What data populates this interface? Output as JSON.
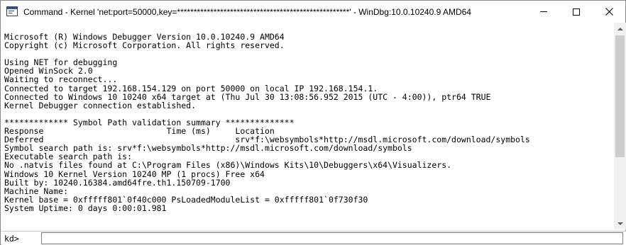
{
  "window": {
    "title": "Command - Kernel 'net:port=50000,key=****************************************************' - WinDbg:10.0.10240.9 AMD64",
    "close_glyph": "✕"
  },
  "output": {
    "lines": [
      "Microsoft (R) Windows Debugger Version 10.0.10240.9 AMD64",
      "Copyright (c) Microsoft Corporation. All rights reserved.",
      "",
      "Using NET for debugging",
      "Opened WinSock 2.0",
      "Waiting to reconnect...",
      "Connected to target 192.168.154.129 on port 50000 on local IP 192.168.154.1.",
      "Connected to Windows 10 10240 x64 target at (Thu Jul 30 13:08:56.952 2015 (UTC - 4:00)), ptr64 TRUE",
      "Kernel Debugger connection established.",
      "",
      "************* Symbol Path validation summary **************",
      "Response                         Time (ms)     Location",
      "Deferred                                       srv*f:\\websymbols*http://msdl.microsoft.com/download/symbols",
      "Symbol search path is: srv*f:\\websymbols*http://msdl.microsoft.com/download/symbols",
      "Executable search path is:",
      "No .natvis files found at C:\\Program Files (x86)\\Windows Kits\\10\\Debuggers\\x64\\Visualizers.",
      "Windows 10 Kernel Version 10240 MP (1 procs) Free x64",
      "Built by: 10240.16384.amd64fre.th1.150709-1700",
      "Machine Name:",
      "Kernel base = 0xfffff801`0f40c000 PsLoadedModuleList = 0xfffff801`0f730f30",
      "System Uptime: 0 days 0:00:01.981"
    ]
  },
  "command": {
    "prompt": "kd>",
    "value": "",
    "placeholder": ""
  },
  "colors": {
    "background": "#ffffff",
    "text": "#000000",
    "scrollbar_track": "#f0f0f0",
    "scrollbar_thumb": "#cdcdcd"
  },
  "icons": {
    "app": "windbg-command-icon",
    "minimize": "minimize-icon",
    "maximize": "maximize-icon",
    "close": "close-icon",
    "scroll_up": "scroll-up-arrow-icon",
    "scroll_down": "scroll-down-arrow-icon"
  }
}
